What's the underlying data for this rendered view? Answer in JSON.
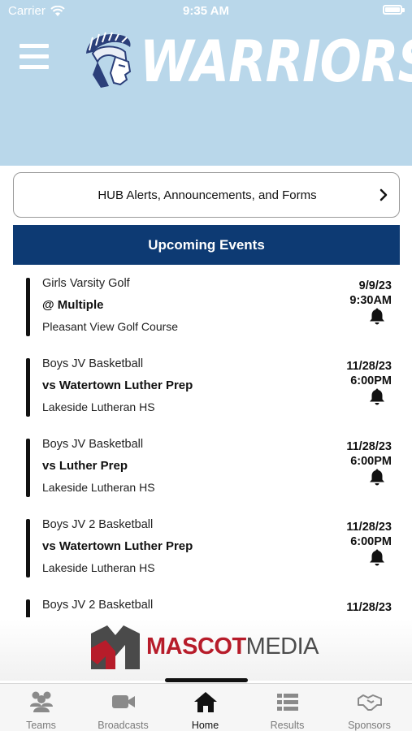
{
  "status_bar": {
    "carrier": "Carrier",
    "time": "9:35 AM"
  },
  "header": {
    "team_name": "WARRIORS"
  },
  "hub_button": {
    "label": "HUB Alerts, Announcements, and Forms"
  },
  "events_section": {
    "title": "Upcoming Events"
  },
  "events": [
    {
      "sport": "Girls Varsity Golf",
      "opponent": "@ Multiple",
      "location": "Pleasant View Golf Course",
      "date": "9/9/23",
      "time": "9:30AM"
    },
    {
      "sport": "Boys JV Basketball",
      "opponent": "vs Watertown Luther Prep",
      "location": "Lakeside Lutheran HS",
      "date": "11/28/23",
      "time": "6:00PM"
    },
    {
      "sport": "Boys JV Basketball",
      "opponent": "vs Luther Prep",
      "location": "Lakeside Lutheran HS",
      "date": "11/28/23",
      "time": "6:00PM"
    },
    {
      "sport": "Boys JV 2 Basketball",
      "opponent": "vs Watertown Luther Prep",
      "location": "Lakeside Lutheran HS",
      "date": "11/28/23",
      "time": "6:00PM"
    },
    {
      "sport": "Boys JV 2 Basketball",
      "opponent": "",
      "location": "",
      "date": "11/28/23",
      "time": ""
    }
  ],
  "sponsor": {
    "name_part1": "MASCOT",
    "name_part2": "MEDIA"
  },
  "tab_bar": {
    "tabs": [
      {
        "label": "Teams",
        "icon": "teams-icon"
      },
      {
        "label": "Broadcasts",
        "icon": "video-camera-icon"
      },
      {
        "label": "Home",
        "icon": "home-icon",
        "active": true
      },
      {
        "label": "Results",
        "icon": "list-icon"
      },
      {
        "label": "Sponsors",
        "icon": "handshake-icon"
      }
    ]
  },
  "colors": {
    "header_bg": "#b9d7ea",
    "events_bar_bg": "#0d3a73",
    "sponsor_red": "#b71c2a"
  }
}
